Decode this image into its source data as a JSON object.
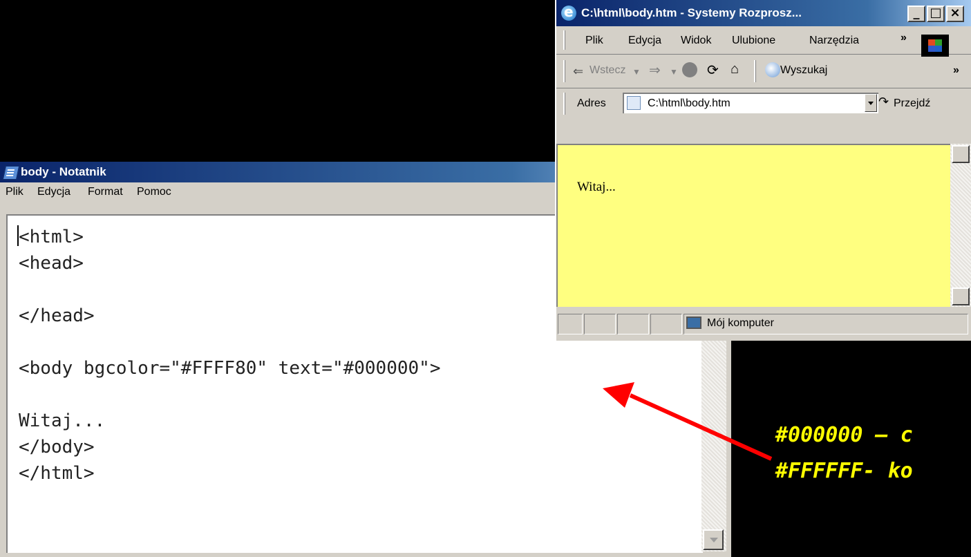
{
  "notepad": {
    "title": "body - Notatnik",
    "menu": [
      "Plik",
      "Edycja",
      "Format",
      "Pomoc"
    ],
    "content": "<html>\n<head>\n\n</head>\n\n<body bgcolor=\"#FFFF80\" text=\"#000000\">\n\nWitaj...\n</body>\n</html>"
  },
  "browser": {
    "title": "C:\\html\\body.htm - Systemy Rozprosz...",
    "window_buttons": [
      "_",
      "□",
      "×"
    ],
    "menu": [
      "Plik",
      "Edycja",
      "Widok",
      "Ulubione",
      "Narzędzia",
      "»"
    ],
    "toolbar": {
      "back_label": "Wstecz",
      "search_label": "Wyszukaj",
      "more": "»"
    },
    "address": {
      "label": "Adres",
      "value": "C:\\html\\body.htm",
      "go_label": "Przejdź"
    },
    "page": {
      "text": "Witaj...",
      "background": "#FFFF80",
      "text_color": "#000000"
    },
    "status": {
      "zone": "Mój komputer"
    }
  },
  "annotation": {
    "line1": "#000000 – c",
    "line2": "#FFFFFF- ko",
    "arrow_color": "#ff0000",
    "text_color": "#ffff00"
  }
}
